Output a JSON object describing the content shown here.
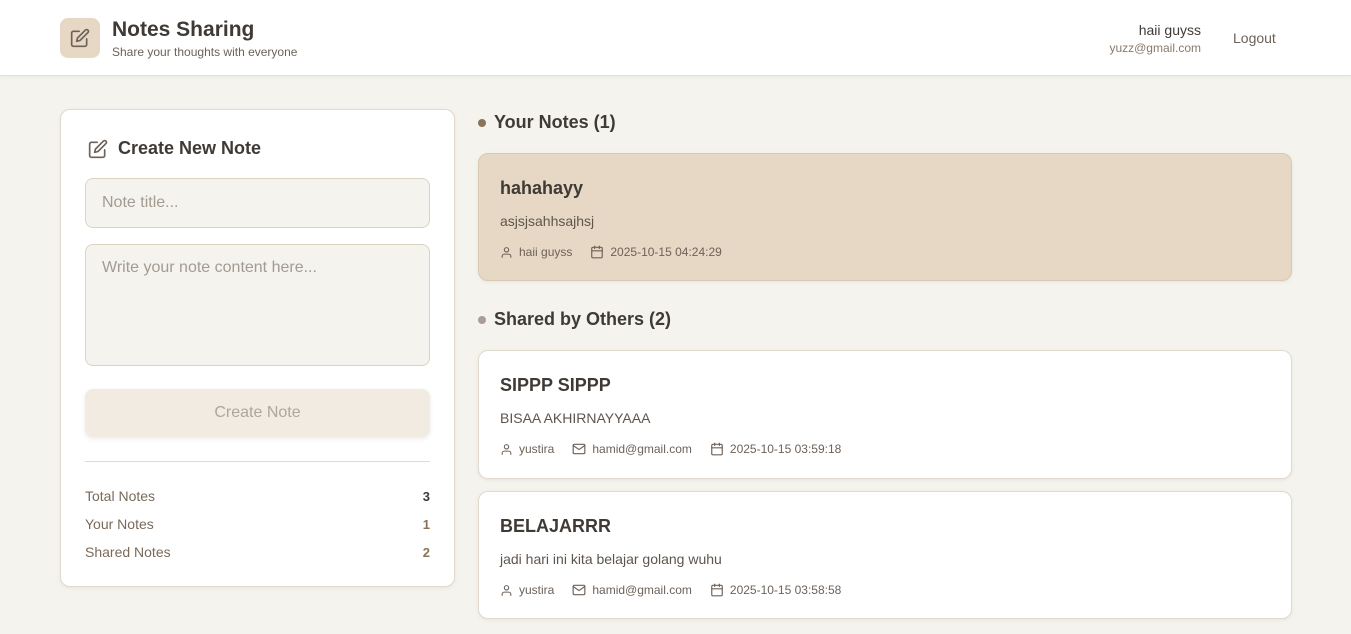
{
  "app": {
    "title": "Notes Sharing",
    "subtitle": "Share your thoughts with everyone"
  },
  "user": {
    "name": "haii guyss",
    "email": "yuzz@gmail.com",
    "logout_label": "Logout"
  },
  "create": {
    "heading": "Create New Note",
    "title_placeholder": "Note title...",
    "content_placeholder": "Write your note content here...",
    "button_label": "Create Note"
  },
  "stats": [
    {
      "label": "Total Notes",
      "value": "3"
    },
    {
      "label": "Your Notes",
      "value": "1"
    },
    {
      "label": "Shared Notes",
      "value": "2"
    }
  ],
  "your_notes": {
    "heading": "Your Notes (1)",
    "notes": [
      {
        "title": "hahahayy",
        "body": "asjsjsahhsajhsj",
        "author": "haii guyss",
        "date": "2025-10-15 04:24:29"
      }
    ]
  },
  "shared": {
    "heading": "Shared by Others (2)",
    "notes": [
      {
        "title": "SIPPP SIPPP",
        "body": "BISAA AKHIRNAYYAAA",
        "author": "yustira",
        "email": "hamid@gmail.com",
        "date": "2025-10-15 03:59:18"
      },
      {
        "title": "BELAJARRR",
        "body": "jadi hari ini kita belajar golang wuhu",
        "author": "yustira",
        "email": "hamid@gmail.com",
        "date": "2025-10-15 03:58:58"
      }
    ]
  },
  "colors": {
    "background": "#f4f3ee",
    "accent": "#e6d8c4",
    "own_dot": "#8a7356",
    "shared_dot": "#a89e94"
  },
  "icons": {
    "logo": "edit-icon",
    "user": "user-icon",
    "mail": "mail-icon",
    "calendar": "calendar-icon"
  }
}
